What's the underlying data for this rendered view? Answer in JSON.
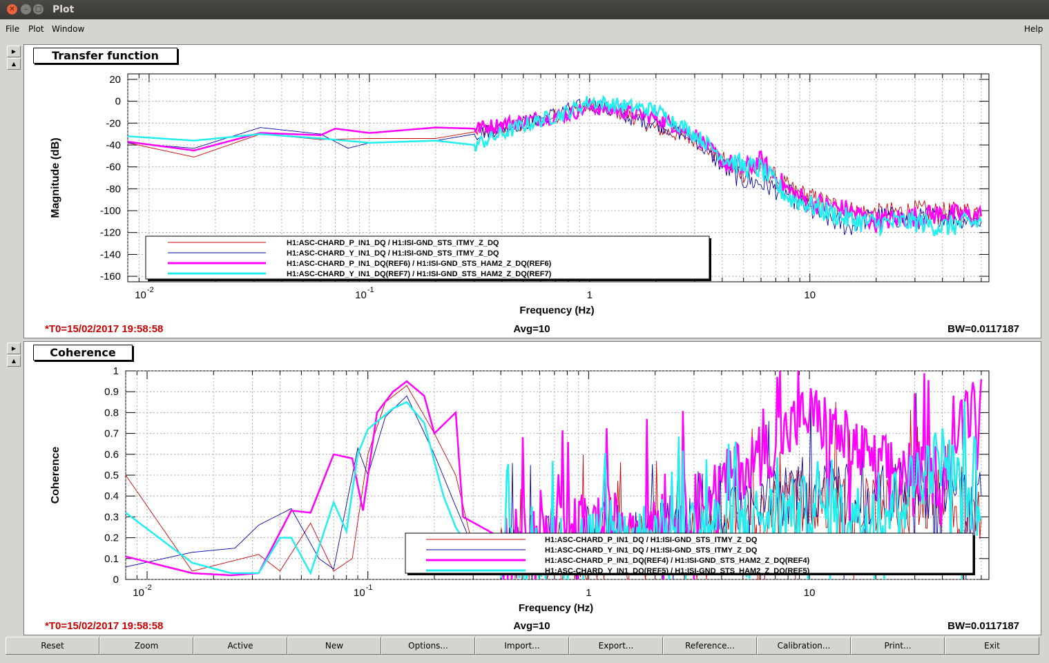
{
  "window": {
    "title": "Plot"
  },
  "menu": {
    "file": "File",
    "plot": "Plot",
    "window": "Window",
    "help": "Help"
  },
  "plots": [
    {
      "panel_title": "Transfer function",
      "status_left": "*T0=15/02/2017 19:58:58",
      "status_center": "Avg=10",
      "status_right": "BW=0.0117187",
      "chart_data": {
        "type": "line",
        "xlabel": "Frequency (Hz)",
        "ylabel": "Magnitude (dB)",
        "x_scale": "log",
        "xlim": [
          0.008,
          65
        ],
        "ylim": [
          -165,
          25
        ],
        "y_ticks": [
          "20",
          "0",
          "-20",
          "-40",
          "-60",
          "-80",
          "-100",
          "-120",
          "-140",
          "-160"
        ],
        "x_tick_labels": [
          {
            "value": 0.01,
            "base": "10",
            "exp": "-2"
          },
          {
            "value": 0.1,
            "base": "10",
            "exp": "-1"
          },
          {
            "value": 1,
            "base": "1",
            "exp": ""
          },
          {
            "value": 10,
            "base": "10",
            "exp": ""
          }
        ],
        "grid": true,
        "legend_position": "bottom-left",
        "series": [
          {
            "name": "H1:ASC-CHARD_P_IN1_DQ / H1:ISI-GND_STS_ITMY_Z_DQ",
            "color": "#cc0000",
            "width": 1,
            "points": [
              [
                0.008,
                -38
              ],
              [
                0.016,
                -51
              ],
              [
                0.032,
                -30
              ],
              [
                0.06,
                -35
              ],
              [
                0.1,
                -34
              ],
              [
                0.2,
                -34
              ],
              [
                0.3,
                -28
              ],
              [
                0.5,
                -22
              ],
              [
                0.8,
                -10
              ],
              [
                1.0,
                -5
              ],
              [
                1.5,
                -12
              ],
              [
                2.0,
                -25
              ],
              [
                3.0,
                -35
              ],
              [
                4.0,
                -55
              ],
              [
                5.0,
                -65
              ],
              [
                6.0,
                -60
              ],
              [
                8.0,
                -80
              ],
              [
                10,
                -88
              ],
              [
                15,
                -100
              ],
              [
                20,
                -103
              ],
              [
                30,
                -100
              ],
              [
                40,
                -102
              ],
              [
                60,
                -100
              ]
            ]
          },
          {
            "name": "H1:ASC-CHARD_Y_IN1_DQ / H1:ISI-GND_STS_ITMY_Z_DQ",
            "color": "#0000aa",
            "width": 1,
            "points": [
              [
                0.008,
                -38
              ],
              [
                0.016,
                -43
              ],
              [
                0.032,
                -24
              ],
              [
                0.06,
                -30
              ],
              [
                0.08,
                -43
              ],
              [
                0.1,
                -38
              ],
              [
                0.2,
                -36
              ],
              [
                0.3,
                -30
              ],
              [
                0.5,
                -20
              ],
              [
                0.8,
                -8
              ],
              [
                1.0,
                -2
              ],
              [
                1.5,
                -15
              ],
              [
                2.0,
                -20
              ],
              [
                3.0,
                -35
              ],
              [
                4.0,
                -60
              ],
              [
                5.0,
                -72
              ],
              [
                6.0,
                -75
              ],
              [
                8.0,
                -85
              ],
              [
                10,
                -100
              ],
              [
                15,
                -115
              ],
              [
                20,
                -105
              ],
              [
                30,
                -108
              ],
              [
                40,
                -104
              ],
              [
                60,
                -110
              ]
            ]
          },
          {
            "name": "H1:ASC-CHARD_P_IN1_DQ(REF6) / H1:ISI-GND_STS_HAM2_Z_DQ(REF6)",
            "color": "#ff00ff",
            "width": 3,
            "points": [
              [
                0.008,
                -37
              ],
              [
                0.016,
                -45
              ],
              [
                0.032,
                -29
              ],
              [
                0.06,
                -31
              ],
              [
                0.07,
                -25
              ],
              [
                0.1,
                -29
              ],
              [
                0.2,
                -24
              ],
              [
                0.3,
                -25
              ],
              [
                0.5,
                -18
              ],
              [
                0.8,
                -12
              ],
              [
                1.0,
                -5
              ],
              [
                1.5,
                -10
              ],
              [
                2.0,
                -15
              ],
              [
                3.0,
                -30
              ],
              [
                4.0,
                -55
              ],
              [
                5.0,
                -62
              ],
              [
                6.0,
                -55
              ],
              [
                8.0,
                -82
              ],
              [
                10,
                -92
              ],
              [
                15,
                -100
              ],
              [
                20,
                -110
              ],
              [
                30,
                -105
              ],
              [
                40,
                -103
              ],
              [
                60,
                -105
              ]
            ]
          },
          {
            "name": "H1:ASC-CHARD_Y_IN1_DQ(REF7) / H1:ISI-GND_STS_HAM2_Z_DQ(REF7)",
            "color": "#22eeee",
            "width": 3,
            "points": [
              [
                0.008,
                -32
              ],
              [
                0.016,
                -36
              ],
              [
                0.032,
                -30
              ],
              [
                0.06,
                -34
              ],
              [
                0.1,
                -38
              ],
              [
                0.2,
                -36
              ],
              [
                0.3,
                -40
              ],
              [
                0.5,
                -22
              ],
              [
                0.8,
                -10
              ],
              [
                1.0,
                0
              ],
              [
                1.5,
                -5
              ],
              [
                2.0,
                -8
              ],
              [
                3.0,
                -30
              ],
              [
                4.0,
                -50
              ],
              [
                5.0,
                -60
              ],
              [
                6.0,
                -62
              ],
              [
                8.0,
                -88
              ],
              [
                10,
                -95
              ],
              [
                15,
                -108
              ],
              [
                20,
                -112
              ],
              [
                30,
                -110
              ],
              [
                40,
                -115
              ],
              [
                60,
                -110
              ]
            ]
          }
        ]
      }
    },
    {
      "panel_title": "Coherence",
      "status_left": "*T0=15/02/2017 19:58:58",
      "status_center": "Avg=10",
      "status_right": "BW=0.0117187",
      "chart_data": {
        "type": "line",
        "xlabel": "Frequency (Hz)",
        "ylabel": "Coherence",
        "x_scale": "log",
        "xlim": [
          0.008,
          65
        ],
        "ylim": [
          0,
          1
        ],
        "y_ticks": [
          "1",
          "0.9",
          "0.8",
          "0.7",
          "0.6",
          "0.5",
          "0.4",
          "0.3",
          "0.2",
          "0.1",
          "0"
        ],
        "x_tick_labels": [
          {
            "value": 0.01,
            "base": "10",
            "exp": "-2"
          },
          {
            "value": 0.1,
            "base": "10",
            "exp": "-1"
          },
          {
            "value": 1,
            "base": "1",
            "exp": ""
          },
          {
            "value": 10,
            "base": "10",
            "exp": ""
          }
        ],
        "grid": true,
        "legend_position": "bottom-right",
        "series": [
          {
            "name": "H1:ASC-CHARD_P_IN1_DQ / H1:ISI-GND_STS_ITMY_Z_DQ",
            "color": "#cc0000",
            "width": 1,
            "points": [
              [
                0.008,
                0.5
              ],
              [
                0.016,
                0.04
              ],
              [
                0.032,
                0.12
              ],
              [
                0.04,
                0.04
              ],
              [
                0.055,
                0.27
              ],
              [
                0.07,
                0.04
              ],
              [
                0.085,
                0.1
              ],
              [
                0.1,
                0.6
              ],
              [
                0.12,
                0.85
              ],
              [
                0.15,
                0.93
              ],
              [
                0.2,
                0.7
              ],
              [
                0.25,
                0.5
              ],
              [
                0.3,
                0.15
              ],
              [
                0.5,
                0.1
              ],
              [
                1.0,
                0.15
              ],
              [
                3.0,
                0.2
              ],
              [
                6.0,
                0.3
              ],
              [
                10,
                0.4
              ],
              [
                20,
                0.35
              ],
              [
                40,
                0.4
              ],
              [
                60,
                0.3
              ]
            ]
          },
          {
            "name": "H1:ASC-CHARD_Y_IN1_DQ / H1:ISI-GND_STS_ITMY_Z_DQ",
            "color": "#0000aa",
            "width": 1,
            "points": [
              [
                0.008,
                0.06
              ],
              [
                0.016,
                0.13
              ],
              [
                0.025,
                0.15
              ],
              [
                0.032,
                0.26
              ],
              [
                0.045,
                0.34
              ],
              [
                0.06,
                0.1
              ],
              [
                0.07,
                0.05
              ],
              [
                0.09,
                0.63
              ],
              [
                0.1,
                0.5
              ],
              [
                0.12,
                0.78
              ],
              [
                0.15,
                0.88
              ],
              [
                0.2,
                0.6
              ],
              [
                0.25,
                0.35
              ],
              [
                0.3,
                0.15
              ],
              [
                0.5,
                0.12
              ],
              [
                1.0,
                0.2
              ],
              [
                3.0,
                0.25
              ],
              [
                6.0,
                0.35
              ],
              [
                10,
                0.45
              ],
              [
                20,
                0.4
              ],
              [
                40,
                0.45
              ],
              [
                60,
                0.4
              ]
            ]
          },
          {
            "name": "H1:ASC-CHARD_P_IN1_DQ(REF4) / H1:ISI-GND_STS_HAM2_Z_DQ(REF4)",
            "color": "#ff00ff",
            "width": 3,
            "points": [
              [
                0.008,
                0.11
              ],
              [
                0.016,
                0.03
              ],
              [
                0.024,
                0.02
              ],
              [
                0.032,
                0.03
              ],
              [
                0.045,
                0.33
              ],
              [
                0.055,
                0.32
              ],
              [
                0.07,
                0.6
              ],
              [
                0.085,
                0.58
              ],
              [
                0.095,
                0.33
              ],
              [
                0.11,
                0.8
              ],
              [
                0.13,
                0.9
              ],
              [
                0.15,
                0.95
              ],
              [
                0.18,
                0.88
              ],
              [
                0.2,
                0.7
              ],
              [
                0.25,
                0.8
              ],
              [
                0.27,
                0.3
              ],
              [
                0.4,
                0.2
              ],
              [
                1.0,
                0.25
              ],
              [
                3.0,
                0.35
              ],
              [
                6.0,
                0.6
              ],
              [
                10,
                0.8
              ],
              [
                20,
                0.55
              ],
              [
                40,
                0.5
              ],
              [
                60,
                0.96
              ]
            ]
          },
          {
            "name": "H1:ASC-CHARD_Y_IN1_DQ(REF5) / H1:ISI-GND_STS_HAM2_Z_DQ(REF5)",
            "color": "#22eeee",
            "width": 3,
            "points": [
              [
                0.008,
                0.32
              ],
              [
                0.016,
                0.08
              ],
              [
                0.024,
                0.03
              ],
              [
                0.032,
                0.03
              ],
              [
                0.04,
                0.2
              ],
              [
                0.045,
                0.2
              ],
              [
                0.055,
                0.03
              ],
              [
                0.07,
                0.37
              ],
              [
                0.08,
                0.23
              ],
              [
                0.09,
                0.6
              ],
              [
                0.1,
                0.72
              ],
              [
                0.13,
                0.82
              ],
              [
                0.15,
                0.85
              ],
              [
                0.18,
                0.75
              ],
              [
                0.22,
                0.4
              ],
              [
                0.25,
                0.25
              ],
              [
                0.3,
                0.12
              ],
              [
                0.5,
                0.1
              ],
              [
                1.0,
                0.2
              ],
              [
                3.0,
                0.25
              ],
              [
                6.0,
                0.3
              ],
              [
                10,
                0.35
              ],
              [
                20,
                0.3
              ],
              [
                40,
                0.6
              ],
              [
                60,
                0.3
              ]
            ]
          }
        ]
      }
    }
  ],
  "buttons": [
    "Reset",
    "Zoom",
    "Active",
    "New",
    "Options...",
    "Import...",
    "Export...",
    "Reference...",
    "Calibration...",
    "Print...",
    "Exit"
  ]
}
